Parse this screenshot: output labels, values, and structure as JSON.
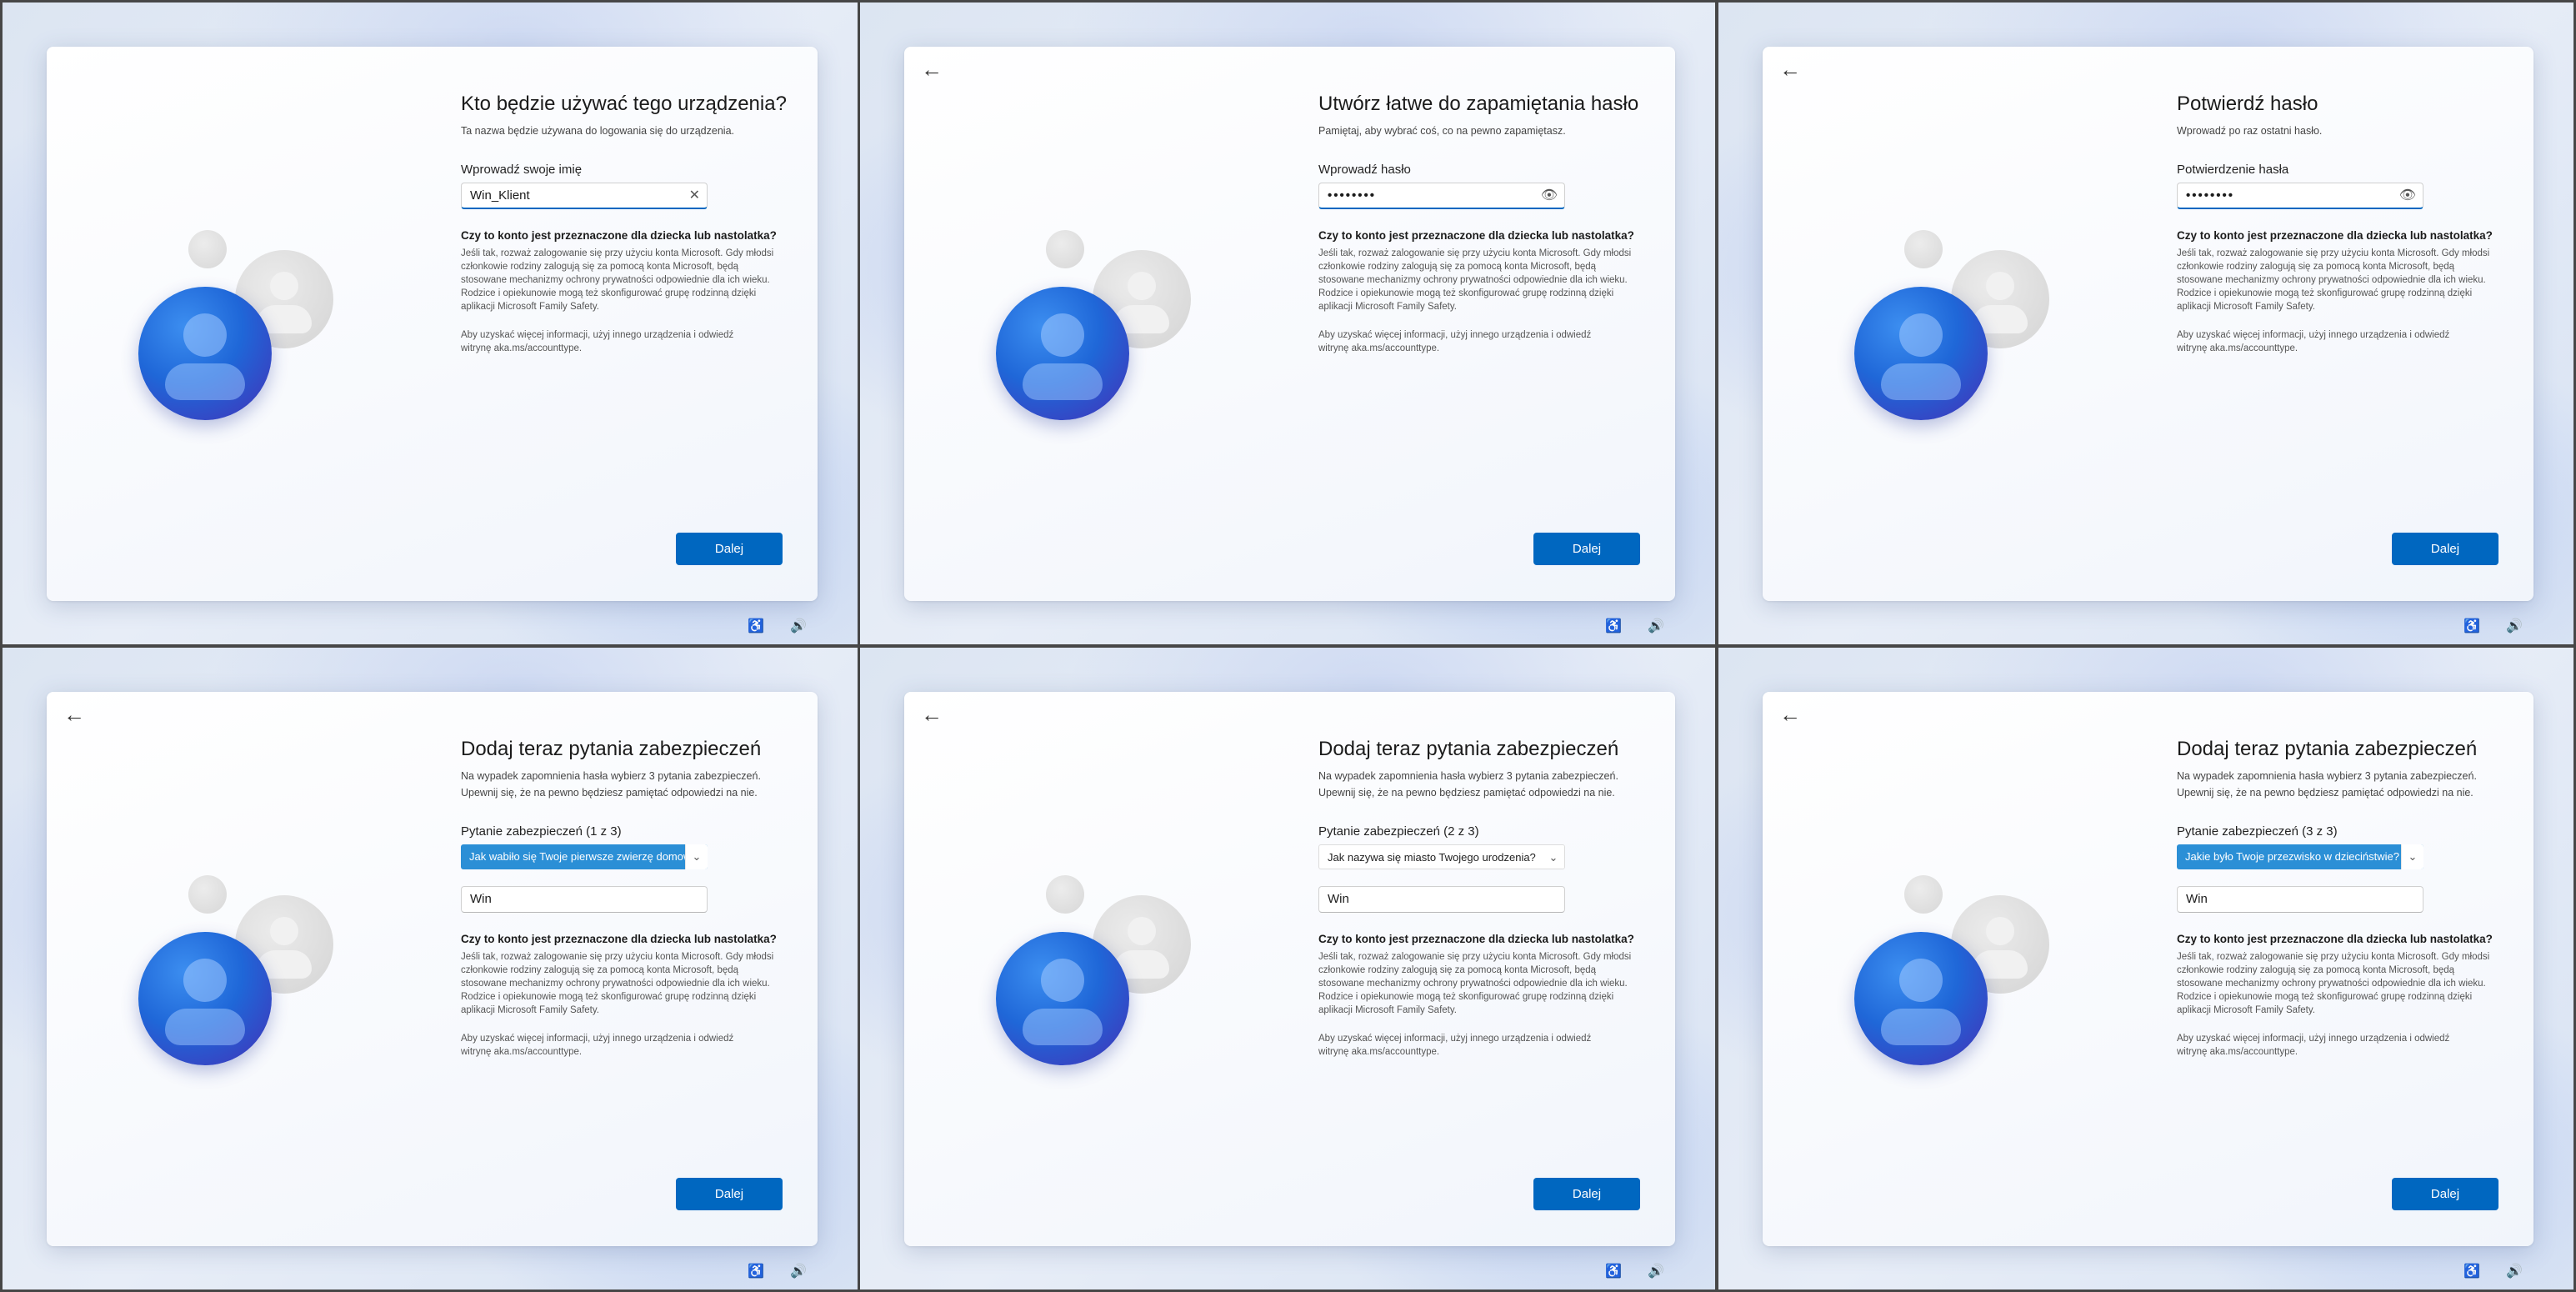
{
  "common": {
    "next_button": "Dalej",
    "back_icon": "←",
    "accessibility_icon": "♿",
    "volume_icon": "🔊",
    "child_title": "Czy to konto jest przeznaczone dla dziecka lub nastolatka?",
    "child_body": "Jeśli tak, rozważ zalogowanie się przy użyciu konta Microsoft. Gdy młodsi członkowie rodziny zalogują się za pomocą konta Microsoft, będą stosowane mechanizmy ochrony prywatności odpowiednie dla ich wieku. Rodzice i opiekunowie mogą też skonfigurować grupę rodzinną dzięki aplikacji Microsoft Family Safety.",
    "more_info": "Aby uzyskać więcej informacji, użyj innego urządzenia i odwiedź witrynę aka.ms/accounttype.",
    "accent_color": "#0067c0"
  },
  "panels": [
    {
      "title": "Kto będzie używać tego urządzenia?",
      "subtitle": "Ta nazwa będzie używana do logowania się do urządzenia.",
      "field_label": "Wprowadź swoje imię",
      "field_value": "Win_Klient",
      "field_icon": "✕"
    },
    {
      "title": "Utwórz łatwe do zapamiętania hasło",
      "subtitle": "Pamiętaj, aby wybrać coś, co na pewno zapamiętasz.",
      "field_label": "Wprowadź hasło",
      "field_value": "••••••••",
      "field_icon": "👁"
    },
    {
      "title": "Potwierdź hasło",
      "subtitle": "Wprowadź po raz ostatni hasło.",
      "field_label": "Potwierdzenie hasła",
      "field_value": "••••••••",
      "field_icon": "👁"
    },
    {
      "title": "Dodaj teraz pytania zabezpieczeń",
      "subtitle": "Na wypadek zapomnienia hasła wybierz 3 pytania zabezpieczeń. Upewnij się, że na pewno będziesz pamiętać odpowiedzi na nie.",
      "field_label": "Pytanie zabezpieczeń (1 z 3)",
      "question": "Jak wabiło się Twoje pierwsze zwierzę domowe?",
      "answer": "Win",
      "chevron": "⌄"
    },
    {
      "title": "Dodaj teraz pytania zabezpieczeń",
      "subtitle": "Na wypadek zapomnienia hasła wybierz 3 pytania zabezpieczeń. Upewnij się, że na pewno będziesz pamiętać odpowiedzi na nie.",
      "field_label": "Pytanie zabezpieczeń (2 z 3)",
      "question": "Jak nazywa się miasto Twojego urodzenia?",
      "answer": "Win",
      "chevron": "⌄"
    },
    {
      "title": "Dodaj teraz pytania zabezpieczeń",
      "subtitle": "Na wypadek zapomnienia hasła wybierz 3 pytania zabezpieczeń. Upewnij się, że na pewno będziesz pamiętać odpowiedzi na nie.",
      "field_label": "Pytanie zabezpieczeń (3 z 3)",
      "question": "Jakie było Twoje przezwisko w dzieciństwie?",
      "answer": "Win",
      "chevron": "⌄"
    }
  ]
}
